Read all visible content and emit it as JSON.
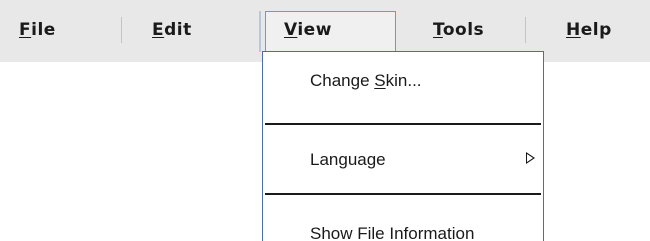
{
  "menubar": {
    "items": [
      {
        "mnemonic": "F",
        "rest": "ile"
      },
      {
        "mnemonic": "E",
        "rest": "dit"
      },
      {
        "mnemonic": "V",
        "rest": "iew"
      },
      {
        "mnemonic": "T",
        "rest": "ools"
      },
      {
        "mnemonic": "H",
        "rest": "elp"
      }
    ]
  },
  "view_menu": {
    "items": [
      {
        "before": "Change ",
        "mnemonic": "S",
        "after": "kin..."
      },
      {
        "label": "Language",
        "submenu_icon": "triangle-right-icon"
      },
      {
        "label": "Show File Information"
      }
    ]
  },
  "colors": {
    "menubar_bg": "#e8e8e8",
    "dropdown_border": "#4a6ea9",
    "text": "#1a1a1a"
  }
}
